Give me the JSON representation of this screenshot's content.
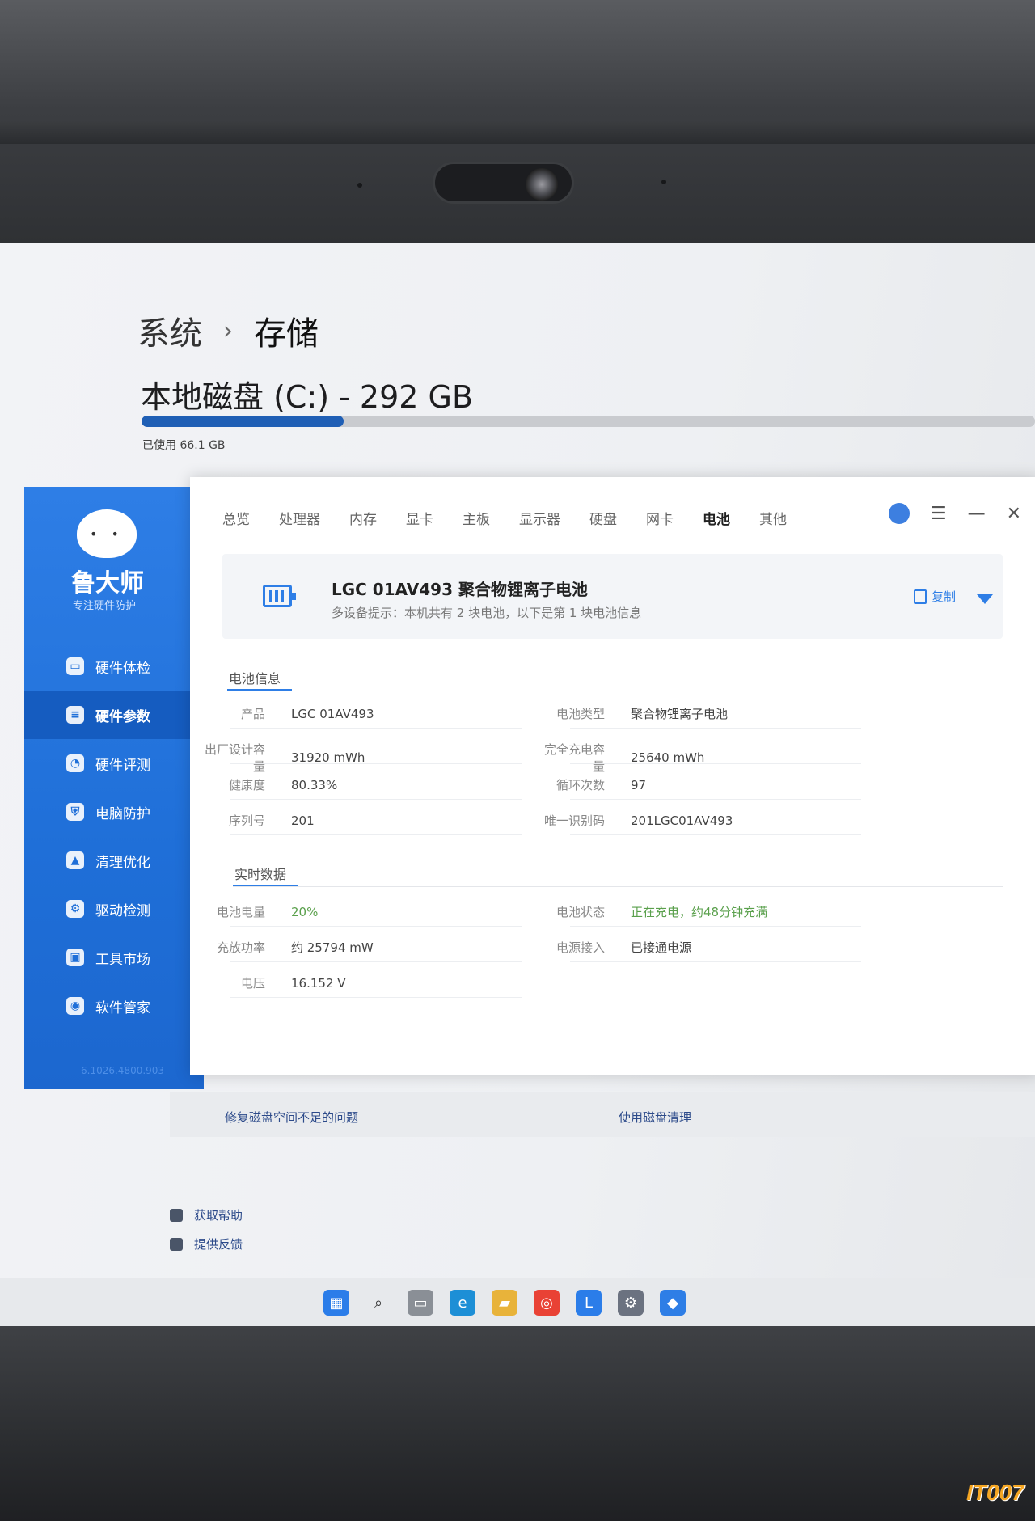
{
  "settings": {
    "breadcrumb_parent": "系统",
    "breadcrumb_separator": "›",
    "breadcrumb_current": "存储",
    "disk_title": "本地磁盘 (C:) - 292 GB",
    "disk_used_label": "已使用 66.1 GB",
    "disk_used_fraction": 0.226,
    "storage_fix_link": "修复磁盘空间不足的问题",
    "disk_cleanup_link": "使用磁盘清理",
    "get_help": "获取帮助",
    "give_feedback": "提供反馈"
  },
  "app": {
    "logo_name": "鲁大师",
    "logo_slogan": "专注硬件防护",
    "version": "6.1026.4800.903",
    "nav": [
      {
        "label": "硬件体检",
        "icon": "monitor-icon",
        "active": false
      },
      {
        "label": "硬件参数",
        "icon": "list-icon",
        "active": true
      },
      {
        "label": "硬件评测",
        "icon": "gauge-icon",
        "active": false
      },
      {
        "label": "电脑防护",
        "icon": "shield-icon",
        "active": false
      },
      {
        "label": "清理优化",
        "icon": "broom-icon",
        "active": false
      },
      {
        "label": "驱动检测",
        "icon": "gear-icon",
        "active": false
      },
      {
        "label": "工具市场",
        "icon": "toolbox-icon",
        "active": false
      },
      {
        "label": "软件管家",
        "icon": "box-icon",
        "active": false
      }
    ],
    "tabs": [
      "总览",
      "处理器",
      "内存",
      "显卡",
      "主板",
      "显示器",
      "硬盘",
      "网卡",
      "电池",
      "其他"
    ],
    "active_tab": "电池",
    "battery": {
      "name": "LGC 01AV493 聚合物锂离子电池",
      "hint": "多设备提示：本机共有 2 块电池，以下是第 1 块电池信息",
      "copy_label": "复制"
    },
    "battery_info": {
      "section_title": "电池信息",
      "left": [
        {
          "label": "产品",
          "value": "LGC 01AV493"
        },
        {
          "label": "出厂设计容量",
          "value": "31920 mWh"
        },
        {
          "label": "健康度",
          "value": "80.33%"
        },
        {
          "label": "序列号",
          "value": "201"
        }
      ],
      "right": [
        {
          "label": "电池类型",
          "value": "聚合物锂离子电池"
        },
        {
          "label": "完全充电容量",
          "value": "25640 mWh"
        },
        {
          "label": "循环次数",
          "value": "97"
        },
        {
          "label": "唯一识别码",
          "value": "201LGC01AV493"
        }
      ]
    },
    "realtime": {
      "section_title": "实时数据",
      "left": [
        {
          "label": "电池电量",
          "value": "20%"
        },
        {
          "label": "充放功率",
          "value": "约 25794 mW"
        },
        {
          "label": "电压",
          "value": "16.152 V"
        }
      ],
      "right": [
        {
          "label": "电池状态",
          "value": "正在充电，约48分钟充满"
        },
        {
          "label": "电源接入",
          "value": "已接通电源"
        }
      ]
    },
    "accent_color": "#2e7ee6",
    "status_green": "#5aa04c"
  },
  "taskbar": {
    "icons": [
      "windows-start-icon",
      "search-icon",
      "task-view-icon",
      "edge-icon",
      "file-explorer-icon",
      "chrome-icon",
      "lenovo-icon",
      "settings-icon",
      "ludashi-icon"
    ]
  },
  "watermark": "IT007"
}
